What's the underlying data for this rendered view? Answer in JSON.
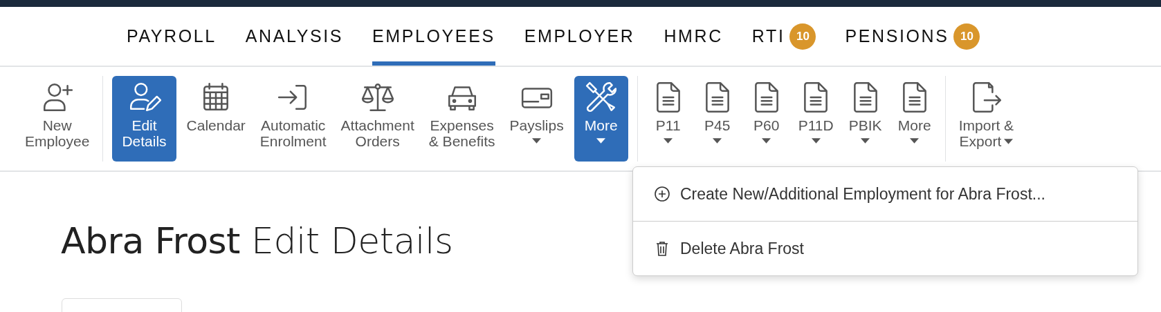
{
  "nav": {
    "tabs": [
      {
        "label": "PAYROLL",
        "selected": false
      },
      {
        "label": "ANALYSIS",
        "selected": false
      },
      {
        "label": "EMPLOYEES",
        "selected": true
      },
      {
        "label": "EMPLOYER",
        "selected": false
      },
      {
        "label": "HMRC",
        "selected": false
      },
      {
        "label": "RTI",
        "selected": false,
        "badge": "10"
      },
      {
        "label": "PENSIONS",
        "selected": false,
        "badge": "10"
      }
    ]
  },
  "toolbar": {
    "groups": [
      [
        {
          "lines": [
            "New",
            "Employee"
          ],
          "selected": false,
          "menu": false
        }
      ],
      [
        {
          "lines": [
            "Edit",
            "Details"
          ],
          "selected": true,
          "menu": false
        },
        {
          "lines": [
            "Calendar"
          ],
          "selected": false,
          "menu": false
        },
        {
          "lines": [
            "Automatic",
            "Enrolment"
          ],
          "selected": false,
          "menu": false
        },
        {
          "lines": [
            "Attachment",
            "Orders"
          ],
          "selected": false,
          "menu": false
        },
        {
          "lines": [
            "Expenses",
            "& Benefits"
          ],
          "selected": false,
          "menu": false
        },
        {
          "lines": [
            "Payslips"
          ],
          "selected": false,
          "menu": true
        },
        {
          "lines": [
            "More"
          ],
          "selected": true,
          "menu": true
        }
      ],
      [
        {
          "lines": [
            "P11"
          ],
          "selected": false,
          "menu": true
        },
        {
          "lines": [
            "P45"
          ],
          "selected": false,
          "menu": true
        },
        {
          "lines": [
            "P60"
          ],
          "selected": false,
          "menu": true
        },
        {
          "lines": [
            "P11D"
          ],
          "selected": false,
          "menu": true
        },
        {
          "lines": [
            "PBIK"
          ],
          "selected": false,
          "menu": true
        },
        {
          "lines": [
            "More"
          ],
          "selected": false,
          "menu": true
        }
      ],
      [
        {
          "lines": [
            "Import &",
            "Export"
          ],
          "selected": false,
          "menu": true
        }
      ]
    ]
  },
  "dropdown": {
    "items": [
      {
        "label": "Create New/Additional Employment for Abra Frost..."
      },
      {
        "label": "Delete Abra Frost"
      }
    ]
  },
  "heading": "**Abra Frost** Edit Details"
}
